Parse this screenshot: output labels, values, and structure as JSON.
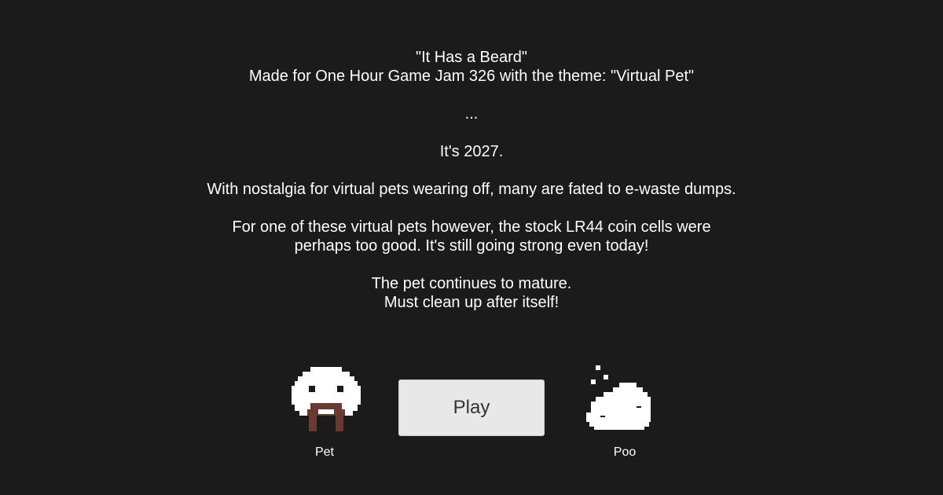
{
  "intro": {
    "title": "\"It Has a Beard\"",
    "subtitle": "Made for One Hour Game Jam 326 with the theme: \"Virtual Pet\"",
    "ellipsis": "...",
    "year_line": "It's 2027.",
    "nostalgia_line": "With nostalgia for virtual pets wearing off, many are fated to e-waste dumps.",
    "coin_cells_line_1": "For one of these virtual pets however, the stock LR44 coin cells were",
    "coin_cells_line_2": "perhaps too good. It's still going strong even today!",
    "mature_line": "The pet continues to mature.",
    "clean_line": "Must clean up after itself!"
  },
  "characters": {
    "pet": {
      "label": "Pet",
      "icon": "bearded-pet-sprite",
      "body_color": "#ffffff",
      "beard_color": "#6b3a2e"
    },
    "poo": {
      "label": "Poo",
      "icon": "poo-sprite",
      "color": "#ffffff"
    }
  },
  "play_button": {
    "label": "Play"
  },
  "colors": {
    "background": "#1b1b1b",
    "text": "#ffffff",
    "button_bg": "#e8e8e8",
    "button_text": "#333333"
  }
}
